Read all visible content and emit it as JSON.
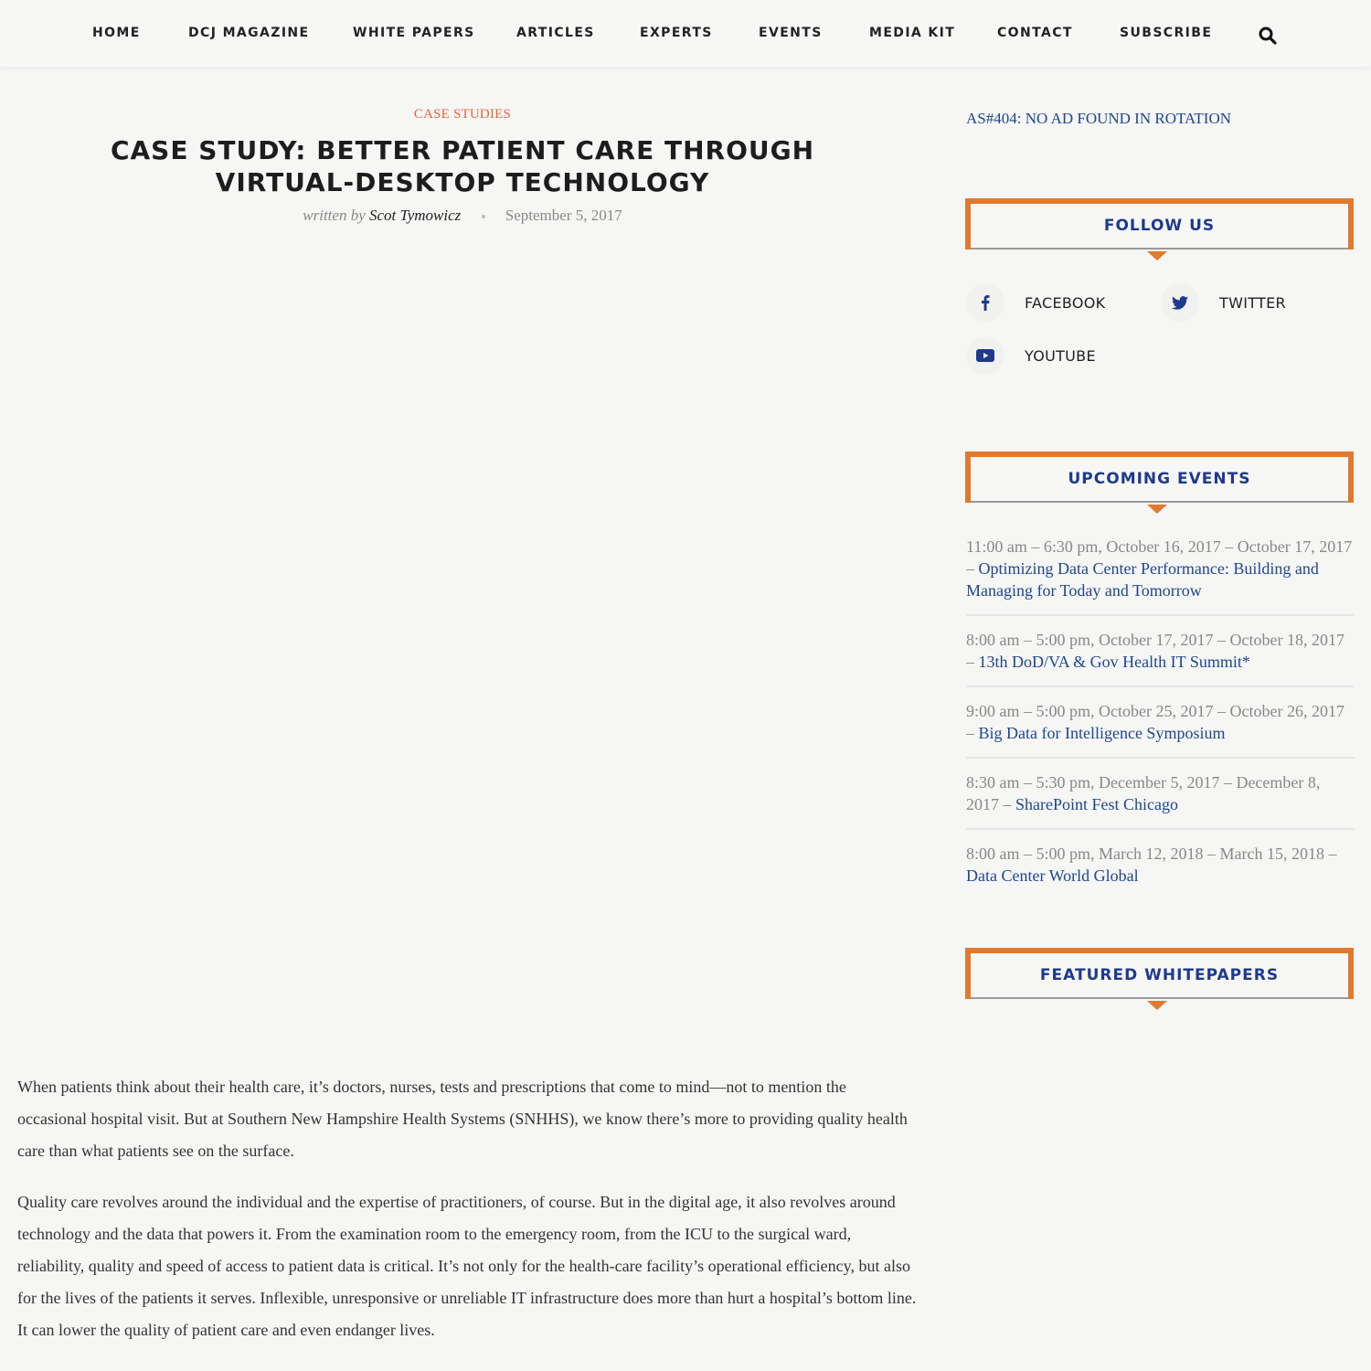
{
  "nav": {
    "items": [
      "HOME",
      "DCJ MAGAZINE",
      "WHITE PAPERS",
      "ARTICLES",
      "EXPERTS",
      "EVENTS",
      "MEDIA KIT",
      "CONTACT",
      "SUBSCRIBE"
    ],
    "search_icon": "search-icon"
  },
  "article": {
    "category": "CASE STUDIES",
    "title": "CASE STUDY: BETTER PATIENT CARE THROUGH VIRTUAL-DESKTOP TECHNOLOGY",
    "written_by": "written by",
    "author": "Scot Tymowicz",
    "date": "September 5, 2017",
    "paragraphs": [
      "When patients think about their health care, it’s doctors, nurses, tests and prescriptions that come to mind—not to mention the occasional hospital visit. But at Southern New Hampshire Health Systems (SNHHS), we know there’s more to providing quality health care than what patients see on the surface.",
      "Quality care revolves around the individual and the expertise of practitioners, of course. But in the digital age, it also revolves around technology and the data that powers it. From the examination room to the emergency room, from the ICU to the surgical ward, reliability, quality and speed of access to patient data is critical. It’s not only for the health-care facility’s operational efficiency, but also for the lives of the patients it serves. Inflexible, unresponsive or unreliable IT infrastructure does more than hurt a hospital’s bottom line. It can lower the quality of patient care and even endanger lives."
    ]
  },
  "sidebar": {
    "ad_text": "AS#404: NO AD FOUND IN ROTATION",
    "follow_us": {
      "title": "FOLLOW US",
      "links": [
        {
          "label": "FACEBOOK",
          "icon": "facebook-icon"
        },
        {
          "label": "TWITTER",
          "icon": "twitter-icon"
        },
        {
          "label": "YOUTUBE",
          "icon": "youtube-icon"
        }
      ]
    },
    "upcoming_events": {
      "title": "UPCOMING EVENTS",
      "items": [
        {
          "when": "11:00 am – 6:30 pm, October 16, 2017 – October 17, 2017 – ",
          "name": "Optimizing Data Center Performance: Building and Managing for Today and Tomorrow"
        },
        {
          "when": "8:00 am – 5:00 pm, October 17, 2017 – October 18, 2017 – ",
          "name": "13th DoD/VA & Gov Health IT Summit*"
        },
        {
          "when": "9:00 am – 5:00 pm, October 25, 2017 – October 26, 2017 – ",
          "name": "Big Data for Intelligence Symposium"
        },
        {
          "when": "8:30 am – 5:30 pm, December 5, 2017 – December 8, 2017 – ",
          "name": "SharePoint Fest Chicago"
        },
        {
          "when": "8:00 am – 5:00 pm, March 12, 2018 – March 15, 2018 – ",
          "name": "Data Center World Global"
        }
      ]
    },
    "featured_whitepapers": {
      "title": "FEATURED WHITEPAPERS"
    }
  },
  "colors": {
    "accent_orange": "#e07a2e",
    "category_orange": "#e0673a",
    "link_blue": "#1e4690",
    "heading_blue": "#1e3a8c"
  }
}
